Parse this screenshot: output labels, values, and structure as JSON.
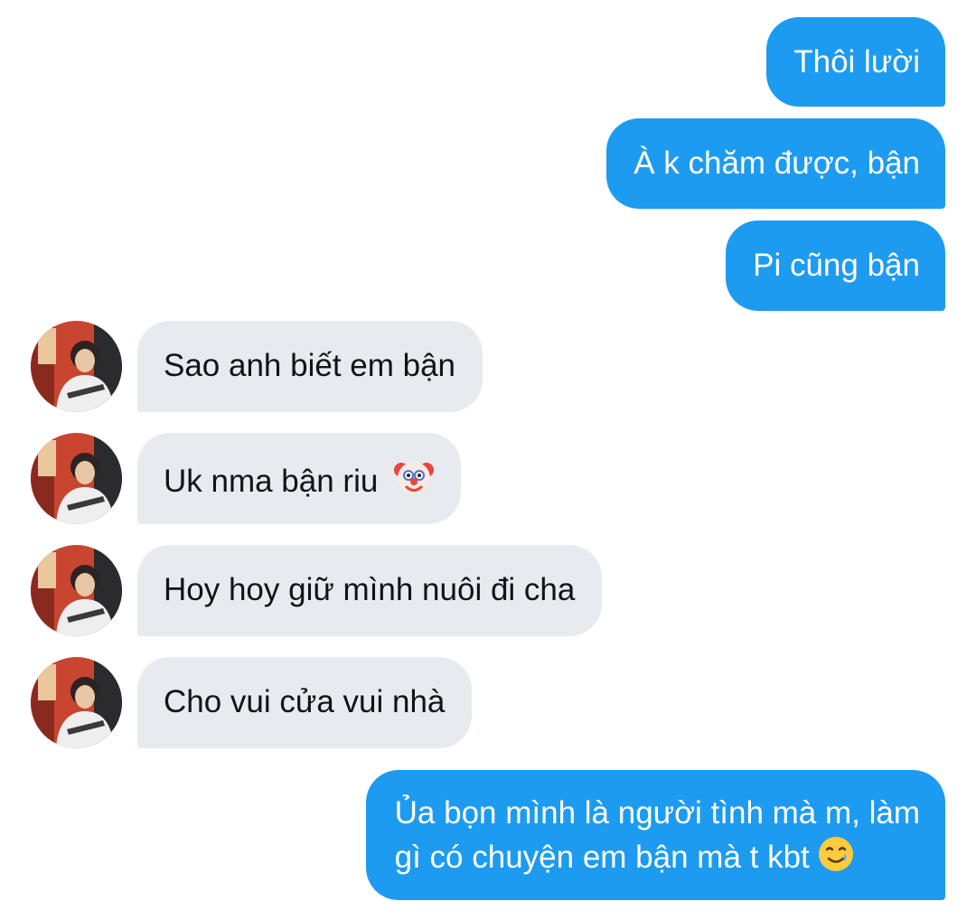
{
  "conversation": {
    "messages": [
      {
        "direction": "outgoing",
        "text": "Thôi lười"
      },
      {
        "direction": "outgoing",
        "text": "À k chăm được, bận"
      },
      {
        "direction": "outgoing",
        "text": "Pi cũng bận"
      },
      {
        "direction": "incoming",
        "text": "Sao anh biết em bận"
      },
      {
        "direction": "incoming",
        "text": "Uk nma bận riu",
        "emoji": "clown-face-icon"
      },
      {
        "direction": "incoming",
        "text": "Hoy hoy giữ mình nuôi đi cha"
      },
      {
        "direction": "incoming",
        "text": "Cho vui cửa vui nhà"
      },
      {
        "direction": "outgoing",
        "lines": [
          "Ủa bọn mình là người tình mà m, làm",
          "gì có chuyện em bận mà t kbt"
        ],
        "emoji": "smiling-face-with-tear-icon"
      }
    ]
  },
  "colors": {
    "outgoing_bubble": "#1d9bf0",
    "outgoing_text": "#ffffff",
    "incoming_bubble": "#e7ebef",
    "incoming_text": "#0f1419",
    "background": "#ffffff"
  }
}
